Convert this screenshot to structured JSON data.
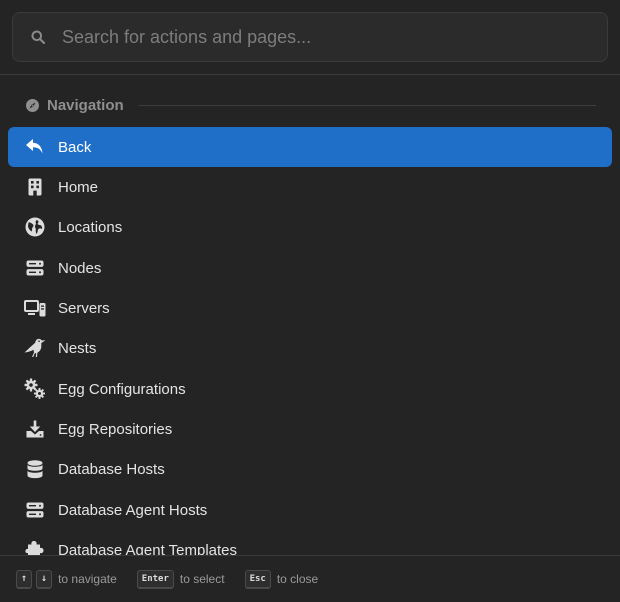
{
  "search": {
    "placeholder": "Search for actions and pages..."
  },
  "section": {
    "title": "Navigation",
    "icon": "compass-icon"
  },
  "items": [
    {
      "label": "Back",
      "icon": "back-arrow-icon",
      "active": true
    },
    {
      "label": "Home",
      "icon": "building-icon"
    },
    {
      "label": "Locations",
      "icon": "globe-icon"
    },
    {
      "label": "Nodes",
      "icon": "server-rack-icon"
    },
    {
      "label": "Servers",
      "icon": "computer-icon"
    },
    {
      "label": "Nests",
      "icon": "crow-icon"
    },
    {
      "label": "Egg Configurations",
      "icon": "gears-icon"
    },
    {
      "label": "Egg Repositories",
      "icon": "download-icon"
    },
    {
      "label": "Database Hosts",
      "icon": "database-icon"
    },
    {
      "label": "Database Agent Hosts",
      "icon": "server-rack-icon"
    },
    {
      "label": "Database Agent Templates",
      "icon": "puzzle-icon"
    }
  ],
  "footer": {
    "up_key": "↑",
    "down_key": "↓",
    "navigate_hint": "to navigate",
    "enter_key": "Enter",
    "select_hint": "to select",
    "esc_key": "Esc",
    "close_hint": "to close"
  },
  "colors": {
    "active": "#1f6fc9",
    "background": "#242424"
  }
}
